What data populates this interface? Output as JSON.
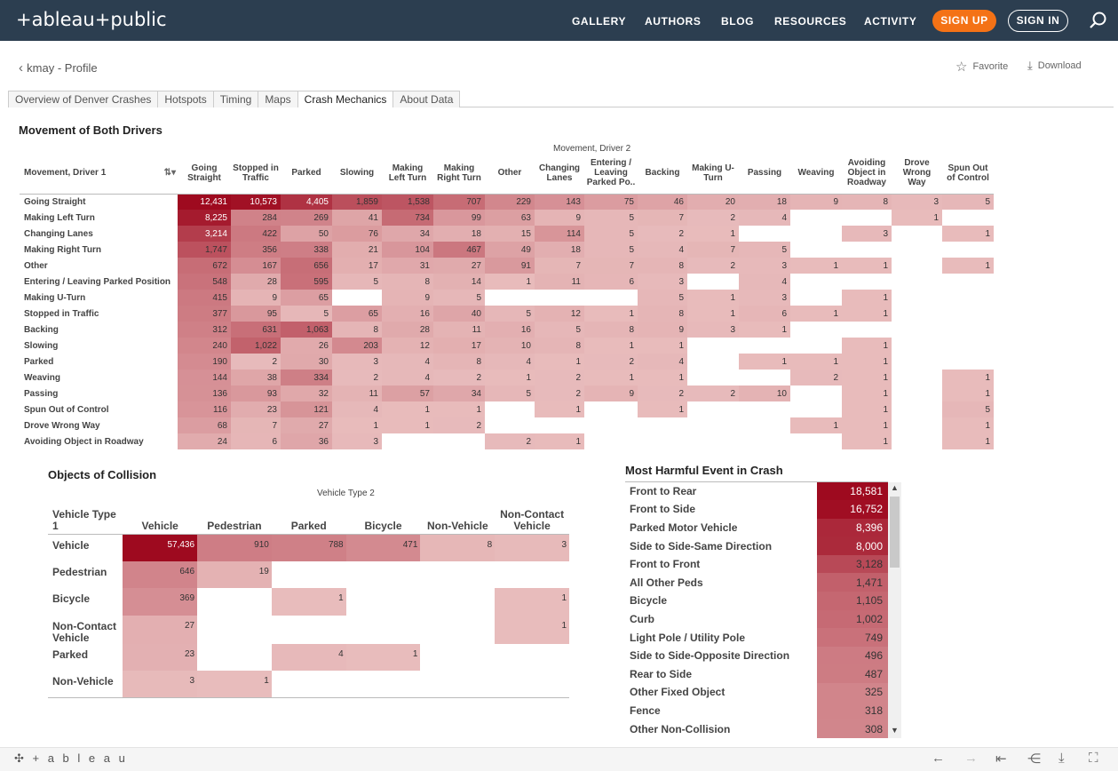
{
  "header": {
    "logo": "+ableau+public",
    "nav": [
      "GALLERY",
      "AUTHORS",
      "BLOG",
      "RESOURCES",
      "ACTIVITY"
    ],
    "signup": "SIGN UP",
    "signin": "SIGN IN"
  },
  "profile": {
    "crumb": "kmay - Profile",
    "favorite": "Favorite",
    "download": "Download"
  },
  "tabs": [
    "Overview of Denver Crashes",
    "Hotspots",
    "Timing",
    "Maps",
    "Crash Mechanics",
    "About Data"
  ],
  "active_tab": "Crash Mechanics",
  "movement": {
    "title": "Movement of Both Drivers",
    "col_header": "Movement, Driver 2",
    "row_header": "Movement, Driver 1",
    "columns": [
      "Going Straight",
      "Stopped in Traffic",
      "Parked",
      "Slowing",
      "Making Left Turn",
      "Making Right Turn",
      "Other",
      "Changing Lanes",
      "Entering / Leaving Parked Po..",
      "Backing",
      "Making U-Turn",
      "Passing",
      "Weaving",
      "Avoiding Object in Roadway",
      "Drove Wrong Way",
      "Spun Out of Control"
    ],
    "rows": [
      {
        "label": "Going Straight",
        "values": [
          "12,431",
          "10,573",
          "4,405",
          "1,859",
          "1,538",
          "707",
          "229",
          "143",
          "75",
          "46",
          "20",
          "18",
          "9",
          "8",
          "3",
          "5"
        ]
      },
      {
        "label": "Making Left Turn",
        "values": [
          "8,225",
          "284",
          "269",
          "41",
          "734",
          "99",
          "63",
          "9",
          "5",
          "7",
          "2",
          "4",
          "",
          "",
          "1",
          ""
        ]
      },
      {
        "label": "Changing Lanes",
        "values": [
          "3,214",
          "422",
          "50",
          "76",
          "34",
          "18",
          "15",
          "114",
          "5",
          "2",
          "1",
          "",
          "",
          "3",
          "",
          "1"
        ]
      },
      {
        "label": "Making Right Turn",
        "values": [
          "1,747",
          "356",
          "338",
          "21",
          "104",
          "467",
          "49",
          "18",
          "5",
          "4",
          "7",
          "5",
          "",
          "",
          "",
          ""
        ]
      },
      {
        "label": "Other",
        "values": [
          "672",
          "167",
          "656",
          "17",
          "31",
          "27",
          "91",
          "7",
          "7",
          "8",
          "2",
          "3",
          "1",
          "1",
          "",
          "1"
        ]
      },
      {
        "label": "Entering / Leaving Parked Position",
        "values": [
          "548",
          "28",
          "595",
          "5",
          "8",
          "14",
          "1",
          "11",
          "6",
          "3",
          "",
          "4",
          "",
          "",
          "",
          ""
        ]
      },
      {
        "label": "Making U-Turn",
        "values": [
          "415",
          "9",
          "65",
          "",
          "9",
          "5",
          "",
          "",
          "",
          "5",
          "1",
          "3",
          "",
          "1",
          "",
          ""
        ]
      },
      {
        "label": "Stopped in Traffic",
        "values": [
          "377",
          "95",
          "5",
          "65",
          "16",
          "40",
          "5",
          "12",
          "1",
          "8",
          "1",
          "6",
          "1",
          "1",
          "",
          ""
        ]
      },
      {
        "label": "Backing",
        "values": [
          "312",
          "631",
          "1,063",
          "8",
          "28",
          "11",
          "16",
          "5",
          "8",
          "9",
          "3",
          "1",
          "",
          "",
          "",
          ""
        ]
      },
      {
        "label": "Slowing",
        "values": [
          "240",
          "1,022",
          "26",
          "203",
          "12",
          "17",
          "10",
          "8",
          "1",
          "1",
          "",
          "",
          "",
          "1",
          "",
          ""
        ]
      },
      {
        "label": "Parked",
        "values": [
          "190",
          "2",
          "30",
          "3",
          "4",
          "8",
          "4",
          "1",
          "2",
          "4",
          "",
          "1",
          "1",
          "1",
          "",
          ""
        ]
      },
      {
        "label": "Weaving",
        "values": [
          "144",
          "38",
          "334",
          "2",
          "4",
          "2",
          "1",
          "2",
          "1",
          "1",
          "",
          "",
          "2",
          "1",
          "",
          "1"
        ]
      },
      {
        "label": "Passing",
        "values": [
          "136",
          "93",
          "32",
          "11",
          "57",
          "34",
          "5",
          "2",
          "9",
          "2",
          "2",
          "10",
          "",
          "1",
          "",
          "1"
        ]
      },
      {
        "label": "Spun Out of Control",
        "values": [
          "116",
          "23",
          "121",
          "4",
          "1",
          "1",
          "",
          "1",
          "",
          "1",
          "",
          "",
          "",
          "1",
          "",
          "5"
        ]
      },
      {
        "label": "Drove Wrong Way",
        "values": [
          "68",
          "7",
          "27",
          "1",
          "1",
          "2",
          "",
          "",
          "",
          "",
          "",
          "",
          "1",
          "1",
          "",
          "1"
        ]
      },
      {
        "label": "Avoiding Object in Roadway",
        "values": [
          "24",
          "6",
          "36",
          "3",
          "",
          "",
          "2",
          "1",
          "",
          "",
          "",
          "",
          "",
          "1",
          "",
          "1"
        ]
      }
    ]
  },
  "objects": {
    "title": "Objects of Collision",
    "col_header": "Vehicle Type 2",
    "row_header": "Vehicle Type 1",
    "columns": [
      "Vehicle",
      "Pedestrian",
      "Parked",
      "Bicycle",
      "Non-Vehicle",
      "Non-Contact Vehicle"
    ],
    "rows": [
      {
        "label": "Vehicle",
        "values": [
          "57,436",
          "910",
          "788",
          "471",
          "8",
          "3"
        ]
      },
      {
        "label": "Pedestrian",
        "values": [
          "646",
          "19",
          "",
          "",
          "",
          ""
        ]
      },
      {
        "label": "Bicycle",
        "values": [
          "369",
          "",
          "1",
          "",
          "",
          "1"
        ]
      },
      {
        "label": "Non-Contact Vehicle",
        "values": [
          "27",
          "",
          "",
          "",
          "",
          "1"
        ]
      },
      {
        "label": "Parked",
        "values": [
          "23",
          "",
          "4",
          "1",
          "",
          ""
        ]
      },
      {
        "label": "Non-Vehicle",
        "values": [
          "3",
          "1",
          "",
          "",
          "",
          ""
        ]
      }
    ]
  },
  "harmful": {
    "title": "Most Harmful Event in Crash",
    "rows": [
      {
        "label": "Front to Rear",
        "value": "18,581"
      },
      {
        "label": "Front to Side",
        "value": "16,752"
      },
      {
        "label": "Parked Motor Vehicle",
        "value": "8,396"
      },
      {
        "label": "Side to Side-Same Direction",
        "value": "8,000"
      },
      {
        "label": "Front to Front",
        "value": "3,128"
      },
      {
        "label": "All Other Peds",
        "value": "1,471"
      },
      {
        "label": "Bicycle",
        "value": "1,105"
      },
      {
        "label": "Curb",
        "value": "1,002"
      },
      {
        "label": "Light Pole / Utility Pole",
        "value": "749"
      },
      {
        "label": "Side to Side-Opposite Direction",
        "value": "496"
      },
      {
        "label": "Rear to Side",
        "value": "487"
      },
      {
        "label": "Other Fixed Object",
        "value": "325"
      },
      {
        "label": "Fence",
        "value": "318"
      },
      {
        "label": "Other Non-Collision",
        "value": "308"
      }
    ]
  },
  "footer": {
    "logo": "+ a b l e a u"
  },
  "colors": {
    "topbar": "#2c3e50",
    "signup": "#f47216",
    "low": "#e8bcbc",
    "high": "#9e0a1f"
  }
}
